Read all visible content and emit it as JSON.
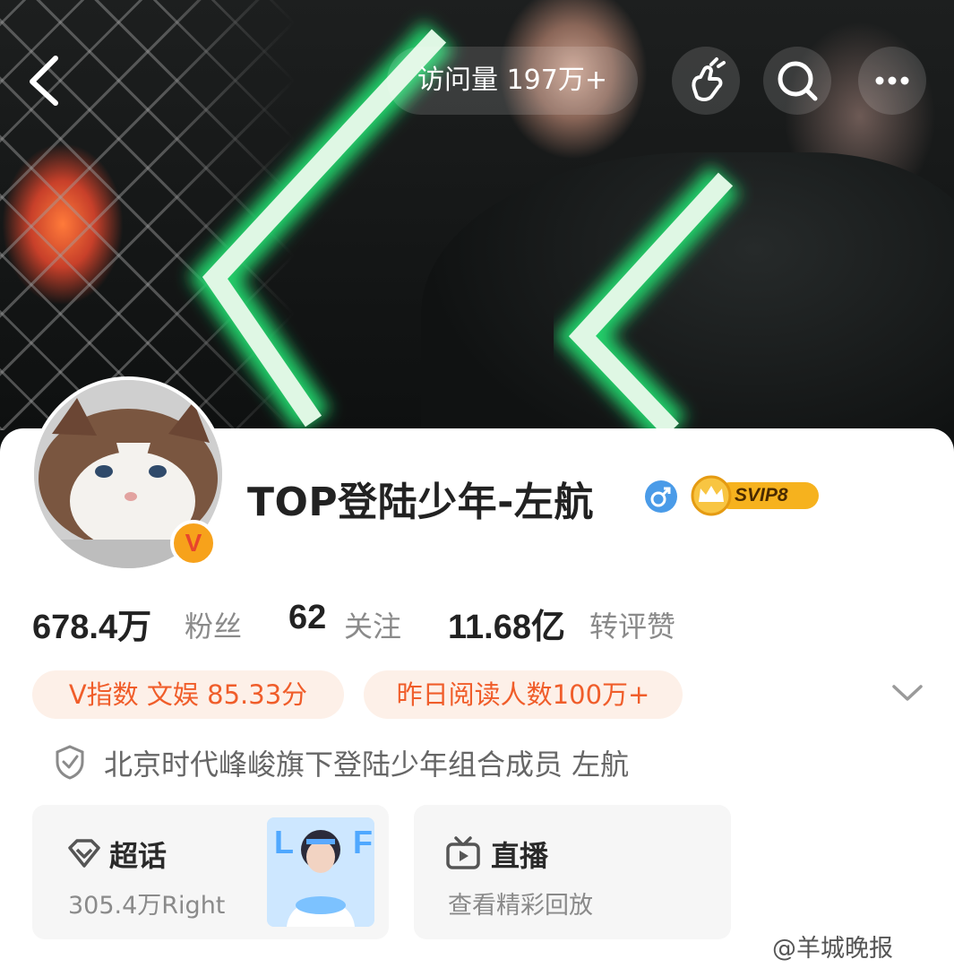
{
  "header": {
    "back_icon": "chevron-left-icon",
    "visit_count": "访问量 197万+",
    "actions": [
      "heart-hand-icon",
      "search-icon",
      "more-icon"
    ]
  },
  "profile": {
    "name": "TOP登陆少年-左航",
    "gender_icon": "male-icon",
    "svip_label": "SVIP8",
    "verified_badge": "V"
  },
  "stats": [
    {
      "value": "678.4万",
      "label": "粉丝"
    },
    {
      "value": "62",
      "label": "关注"
    },
    {
      "value": "11.68亿",
      "label": "转评赞"
    }
  ],
  "tags": [
    "V指数 文娱 85.33分",
    "昨日阅读人数100万+"
  ],
  "description": "北京时代峰峻旗下登陆少年组合成员 左航",
  "cards": [
    {
      "title": "超话",
      "subtitle": "305.4万Right",
      "icon": "supertopic-icon"
    },
    {
      "title": "直播",
      "subtitle": "查看精彩回放",
      "icon": "tv-icon"
    }
  ],
  "watermark": "@羊城晚报",
  "colors": {
    "accent": "#f05d2a",
    "tag_bg": "#fdf0e8",
    "gender": "#4a9be8",
    "svip_gold": "#f6b21e"
  }
}
